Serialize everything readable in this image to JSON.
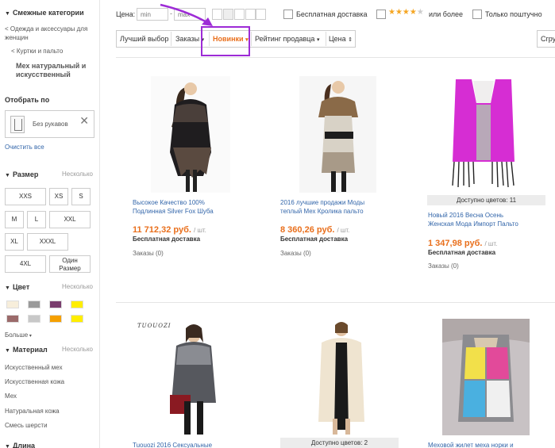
{
  "sidebar": {
    "related_title": "Смежные категории",
    "breadcrumb1_line1": "< Одежда и аксессуары для",
    "breadcrumb1_line2": "женщин",
    "breadcrumb2": "< Куртки и пальто",
    "current_line1": "Мех натуральный и",
    "current_line2": "искусственный",
    "selected_title": "Отобрать по",
    "selected_filter": "Без рукавов",
    "clear_all": "Очистить все",
    "size_title": "Размер",
    "multi_label": "Несколько",
    "sizes": [
      "XXS",
      "XS",
      "S",
      "M",
      "L",
      "XXL",
      "XL",
      "XXXL",
      "4XL"
    ],
    "one_size_line1": "Один",
    "one_size_line2": "Размер",
    "color_title": "Цвет",
    "colors": [
      "#f7eedb",
      "#9a9a9a",
      "#7a3e6e",
      "#ffee00",
      "#9b6a6a",
      "#c8c8c8",
      "#f5a000",
      "#ffee00"
    ],
    "more": "Больше",
    "material_title": "Материал",
    "materials": [
      "Искусственный мех",
      "Искусственная кожа",
      "Мех",
      "Натуральная кожа",
      "Смесь шерсти"
    ],
    "length_title": "Длина"
  },
  "topbar": {
    "price_label": "Цена:",
    "min_placeholder": "min",
    "max_placeholder": "max",
    "free_shipping": "Бесплатная доставка",
    "rating_suffix": "или более",
    "rating_stars": "★★★★",
    "rating_star_empty": "★",
    "wholesale": "Только поштучно"
  },
  "sort": {
    "best": "Лучший выбор",
    "orders": "Заказы",
    "newest": "Новинки",
    "seller_rating": "Рейтинг продавца",
    "price": "Цена",
    "cut_button": "Сгру"
  },
  "products": [
    {
      "title_line1": "Высокое Качество 100%",
      "title_line2": "Подлинная Silver Fox Шуба",
      "price": "11 712,32 руб.",
      "unit": "/ шт.",
      "shipping": "Бесплатная доставка",
      "orders": "Заказы (0)"
    },
    {
      "title_line1": "2016 лучшие продажи Моды",
      "title_line2": "теплый Мех Кролика пальто",
      "price": "8 360,26 руб.",
      "unit": "/ шт.",
      "shipping": "Бесплатная доставка",
      "orders": "Заказы (0)"
    },
    {
      "colors_available": "Доступно цветов: 11",
      "title_line1": "Новый 2016 Весна Осень",
      "title_line2": "Женская Мода Импорт Пальто",
      "price": "1 347,98 руб.",
      "unit": "/ шт.",
      "shipping": "Бесплатная доставка",
      "orders": "Заказы (0)"
    },
    {
      "brand_logo": "TUOUOZI",
      "title_line1": "Tuouozi 2016 Сексуальные"
    },
    {
      "colors_available": "Доступно цветов: 2"
    },
    {
      "title_line1": "Меховой жилет меха норки и"
    }
  ],
  "colors": {
    "accent_orange": "#e96f1c",
    "link_blue": "#3366aa",
    "annotation_purple": "#9d2bd6"
  }
}
